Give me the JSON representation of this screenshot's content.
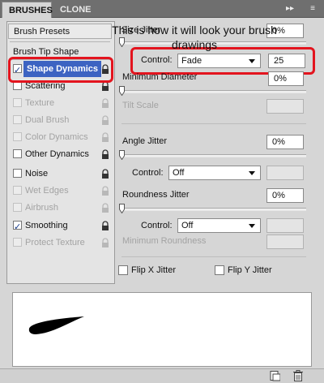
{
  "tabs": [
    {
      "label": "BRUSHES"
    },
    {
      "label": "CLONE SOURCE"
    }
  ],
  "window_controls": {
    "collapse_icon": "double-arrow-icon",
    "menu_icon": "panel-menu-icon"
  },
  "left": {
    "presets_label": "Brush Presets",
    "tip_shape_label": "Brush Tip Shape",
    "items": [
      {
        "label": "Shape Dynamics",
        "checked": true,
        "enabled": true,
        "selected": true
      },
      {
        "label": "Scattering",
        "checked": false,
        "enabled": true
      },
      {
        "label": "Texture",
        "checked": false,
        "enabled": false
      },
      {
        "label": "Dual Brush",
        "checked": false,
        "enabled": false
      },
      {
        "label": "Color Dynamics",
        "checked": false,
        "enabled": false
      },
      {
        "label": "Other Dynamics",
        "checked": false,
        "enabled": true
      },
      {
        "label": "Noise",
        "checked": false,
        "enabled": true
      },
      {
        "label": "Wet Edges",
        "checked": false,
        "enabled": false
      },
      {
        "label": "Airbrush",
        "checked": false,
        "enabled": false
      },
      {
        "label": "Smoothing",
        "checked": true,
        "enabled": true
      },
      {
        "label": "Protect Texture",
        "checked": false,
        "enabled": false
      }
    ]
  },
  "right": {
    "size_jitter": {
      "label": "Size Jitter",
      "value": "0%"
    },
    "size_control": {
      "label": "Control:",
      "selected": "Fade",
      "value": "25"
    },
    "min_diameter": {
      "label": "Minimum Diameter",
      "value": "0%"
    },
    "tilt_scale": {
      "label": "Tilt Scale"
    },
    "angle_jitter": {
      "label": "Angle Jitter",
      "value": "0%"
    },
    "angle_control": {
      "label": "Control:",
      "selected": "Off"
    },
    "roundness_jitter": {
      "label": "Roundness Jitter",
      "value": "0%"
    },
    "roundness_control": {
      "label": "Control:",
      "selected": "Off"
    },
    "min_roundness": {
      "label": "Minimum Roundness"
    },
    "flip_x": {
      "label": "Flip X Jitter",
      "checked": false
    },
    "flip_y": {
      "label": "Flip Y Jitter",
      "checked": false
    }
  },
  "preview": {
    "text": "This is how it will look your brush drawings"
  },
  "bottom": {
    "new_icon": "new-brush-icon",
    "trash_icon": "trash-icon"
  },
  "colors": {
    "highlight": "#3c63c2",
    "callout": "#e3141e"
  }
}
